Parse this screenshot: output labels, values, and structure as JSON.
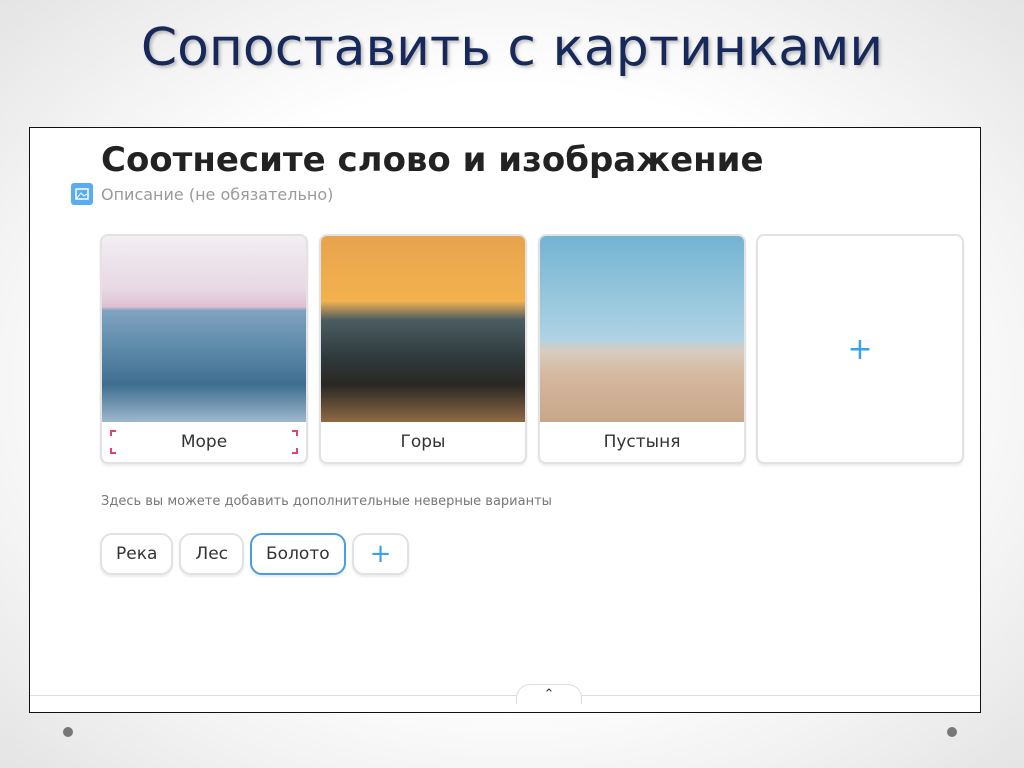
{
  "slide": {
    "title": "Сопоставить с картинками"
  },
  "editor": {
    "heading": "Соотнесите слово и изображение",
    "description_placeholder": "Описание (не обязательно)",
    "cards": [
      {
        "label": "Море"
      },
      {
        "label": "Горы"
      },
      {
        "label": "Пустыня"
      }
    ],
    "add_card": "+",
    "hint": "Здесь вы можете добавить дополнительные неверные варианты",
    "distractors": [
      "Река",
      "Лес",
      "Болото"
    ],
    "add_distractor": "+",
    "collapse": "⌃"
  },
  "colors": {
    "accent": "#3aa0e8",
    "title": "#17295a"
  }
}
